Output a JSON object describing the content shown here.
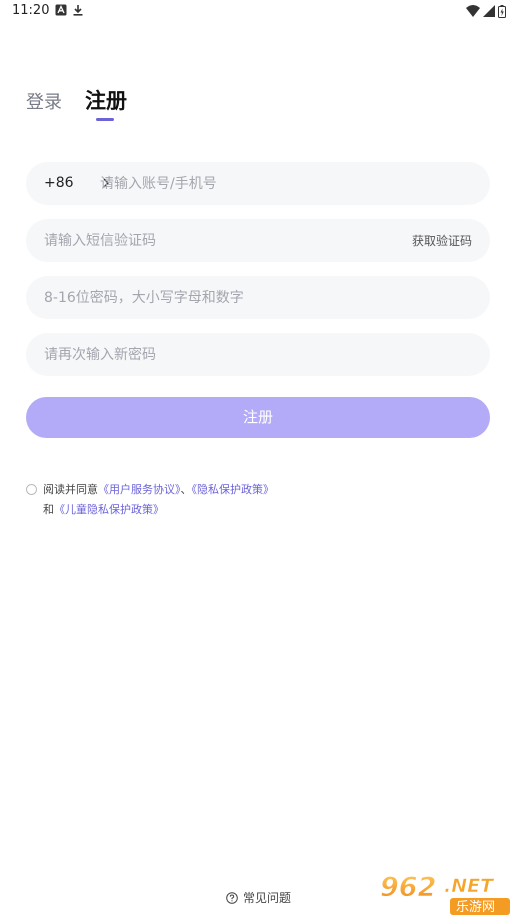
{
  "status_bar": {
    "time": "11:20"
  },
  "tabs": {
    "login": "登录",
    "register": "注册"
  },
  "phone_field": {
    "country_code": "+86",
    "placeholder": "请输入账号/手机号"
  },
  "sms_field": {
    "placeholder": "请输入短信验证码",
    "get_code_label": "获取验证码"
  },
  "password_field": {
    "placeholder": "8-16位密码，大小写字母和数字"
  },
  "confirm_field": {
    "placeholder": "请再次输入新密码"
  },
  "submit": {
    "label": "注册"
  },
  "agreement": {
    "prefix": "阅读并同意",
    "user_agreement": "《用户服务协议》",
    "separator": "、",
    "privacy_policy": "《隐私保护政策》",
    "and": "和",
    "children_policy": "《儿童隐私保护政策》"
  },
  "faq": {
    "label": "常见问题"
  },
  "watermark": {
    "text": "962.NET",
    "subtext": "乐游网"
  },
  "colors": {
    "accent": "#6c63d9",
    "button": "#b3abf7",
    "field_bg": "#f6f7f9"
  }
}
